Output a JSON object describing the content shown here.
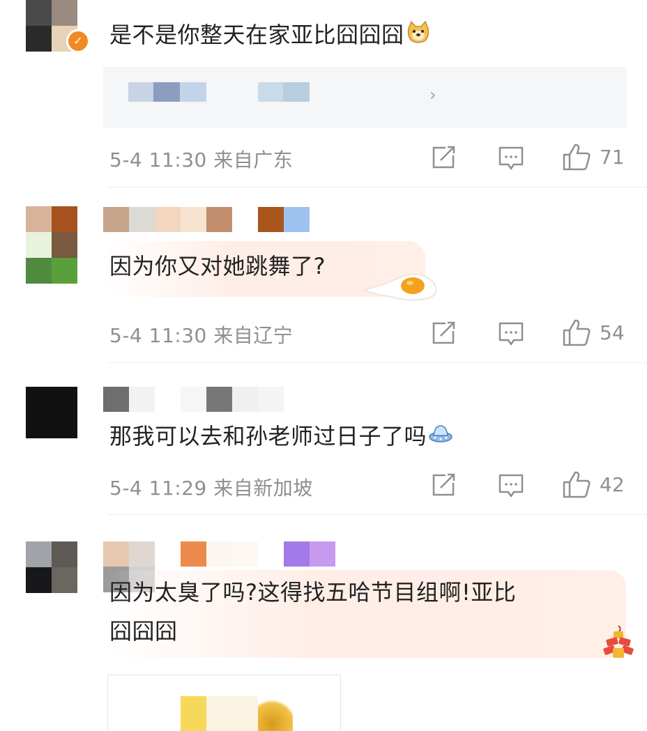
{
  "comments": [
    {
      "text": "是不是你整天在家亚比囧囧囧",
      "emoji": "doge-emoji",
      "repost_link": "›",
      "meta": "5-4 11:30 来自广东",
      "likes": "71",
      "verified": true
    },
    {
      "text": "因为你又对她跳舞了?",
      "meta": "5-4 11:30 来自辽宁",
      "likes": "54"
    },
    {
      "text": "那我可以去和孙老师过日子了吗",
      "emoji": "ufo-emoji",
      "meta": "5-4 11:29 来自新加坡",
      "likes": "42"
    },
    {
      "text_line1": "因为太臭了吗?这得找五哈节目组啊!亚比",
      "text_line2": "囧囧囧",
      "emoji": "firecracker-emoji"
    }
  ],
  "colors": {
    "meta_text": "#8f8f8f",
    "body_text": "#222222",
    "verified_badge": "#f08a24"
  }
}
